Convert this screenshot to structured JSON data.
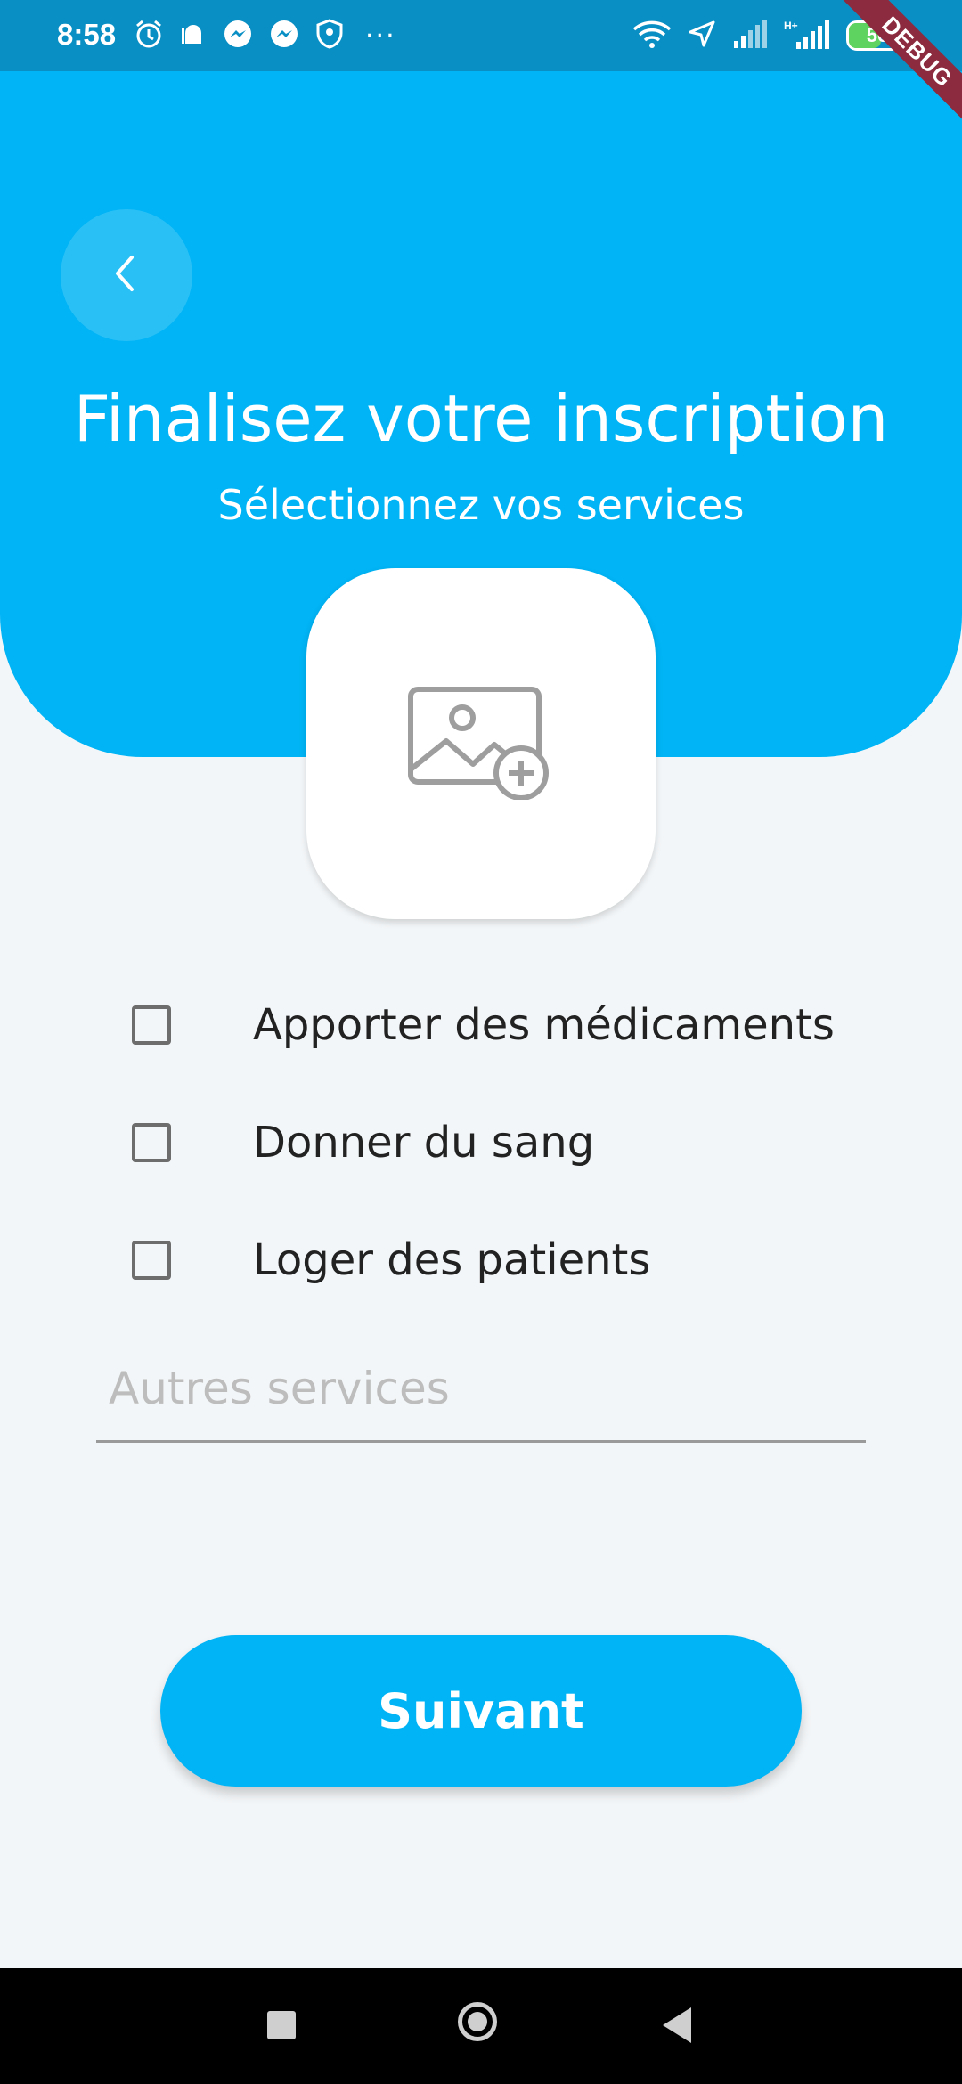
{
  "status_bar": {
    "time": "8:58",
    "battery_level": "56",
    "battery_fraction": 0.56,
    "left_icons": [
      "alarm-icon",
      "mosque-icon",
      "messenger-icon",
      "messenger-icon",
      "shield-icon"
    ],
    "more": "···",
    "right_icons": [
      "wifi-icon",
      "location-arrow-icon",
      "signal-icon",
      "h-plus-signal-icon",
      "battery-icon"
    ]
  },
  "debug_banner": "DEBUG",
  "header": {
    "back_icon": "chevron-left-icon",
    "title": "Finalisez votre inscription",
    "subtitle": "Sélectionnez vos services"
  },
  "image_picker": {
    "icon": "add-image-icon"
  },
  "services": [
    {
      "label": "Apporter des médicaments",
      "checked": false
    },
    {
      "label": "Donner du sang",
      "checked": false
    },
    {
      "label": "Loger des patients",
      "checked": false
    }
  ],
  "other_services": {
    "placeholder": "Autres services",
    "value": ""
  },
  "next_button": {
    "label": "Suivant"
  },
  "colors": {
    "primary": "#00b4f5",
    "status_bar": "#0a8fc4",
    "background": "#f3f6f8",
    "debug": "#8c2b3f"
  },
  "nav_bar": {
    "icons": [
      "recent-apps-icon",
      "home-icon",
      "back-icon"
    ]
  }
}
